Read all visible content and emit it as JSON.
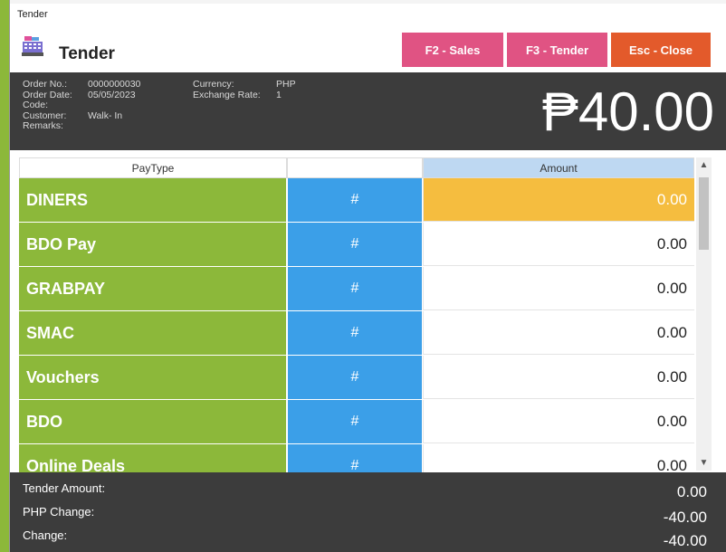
{
  "window": {
    "title": "Tender"
  },
  "header": {
    "heading": "Tender",
    "logo_icon": "cash-register-icon"
  },
  "buttons": {
    "sales": "F2 - Sales",
    "tender": "F3 - Tender",
    "close": "Esc - Close"
  },
  "colors": {
    "green": "#8cb83a",
    "blue": "#3b9fe8",
    "pink": "#e05383",
    "orange": "#e35a2b",
    "active_amount": "#f5bd3f",
    "dark": "#3c3c3c"
  },
  "order": {
    "labels": {
      "order_no": "Order No.:",
      "order_date": "Order Date:",
      "code": "Code:",
      "customer": "Customer:",
      "remarks": "Remarks:",
      "currency": "Currency:",
      "exchange_rate": "Exchange Rate:"
    },
    "order_no": "0000000030",
    "order_date": "05/05/2023",
    "code": "",
    "customer": "Walk- In",
    "remarks": "",
    "currency": "PHP",
    "exchange_rate": "1",
    "total": "₱40.00"
  },
  "grid": {
    "columns": {
      "paytype": "PayType",
      "action": "",
      "amount": "Amount"
    },
    "rows": [
      {
        "paytype": "DINERS",
        "action": "#",
        "amount": "0.00"
      },
      {
        "paytype": "BDO Pay",
        "action": "#",
        "amount": "0.00"
      },
      {
        "paytype": "GRABPAY",
        "action": "#",
        "amount": "0.00"
      },
      {
        "paytype": "SMAC",
        "action": "#",
        "amount": "0.00"
      },
      {
        "paytype": "Vouchers",
        "action": "#",
        "amount": "0.00"
      },
      {
        "paytype": "BDO",
        "action": "#",
        "amount": "0.00"
      },
      {
        "paytype": "Online Deals",
        "action": "#",
        "amount": "0.00"
      }
    ]
  },
  "footer": {
    "tender_amount_label": "Tender Amount:",
    "tender_amount": "0.00",
    "php_change_label": "PHP Change:",
    "php_change": "-40.00",
    "change_label": "Change:",
    "change": "-40.00"
  }
}
